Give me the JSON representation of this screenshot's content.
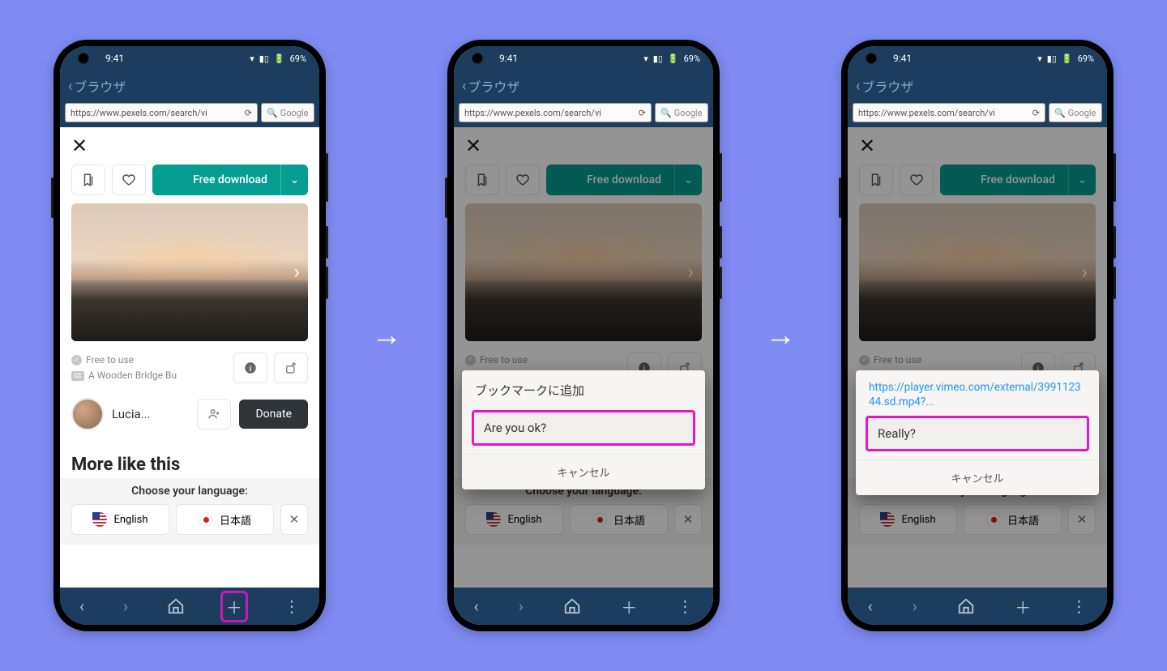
{
  "status": {
    "time": "9:41",
    "battery": "69%"
  },
  "app": {
    "title": "ブラウザ",
    "url": "https://www.pexels.com/search/vi",
    "search_engine": "Google"
  },
  "page": {
    "download": "Free download",
    "free_label": "Free to use",
    "img_title": "A Wooden Bridge Bu",
    "author": "Lucia...",
    "donate": "Donate",
    "more": "More like this",
    "lang_header": "Choose your language:",
    "lang_en": "English",
    "lang_jp": "日本語"
  },
  "dialog1": {
    "title": "ブックマークに追加",
    "field": "Are you ok?",
    "cancel": "キャンセル"
  },
  "dialog2": {
    "link": "https://player.vimeo.com/external/399112344.sd.mp4?...",
    "field": "Really?",
    "cancel": "キャンセル"
  }
}
